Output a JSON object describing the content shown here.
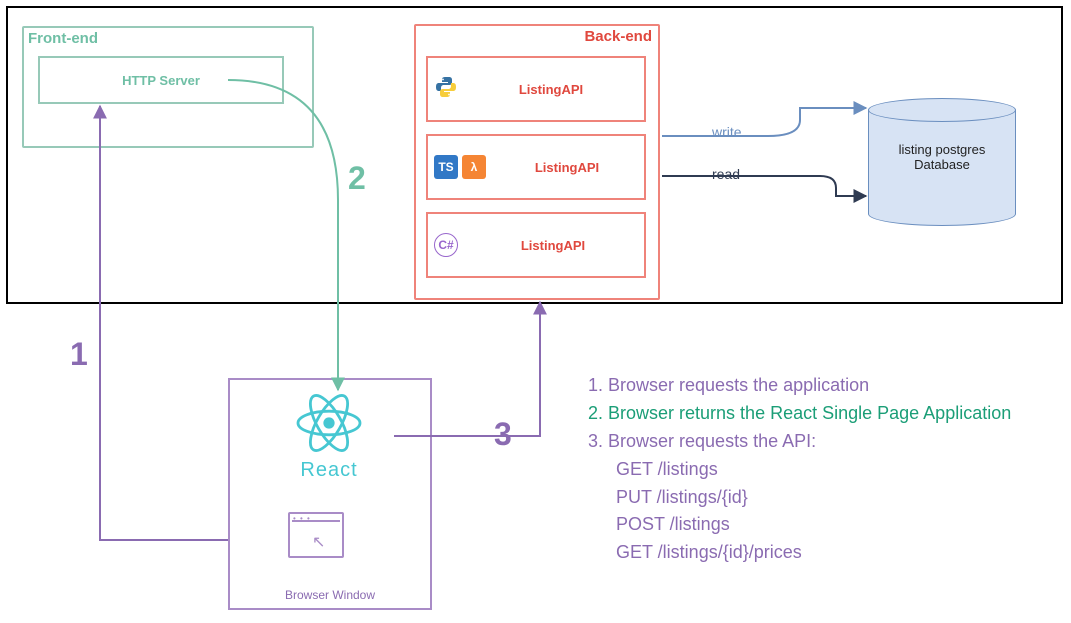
{
  "boxes": {
    "frontend_title": "Front-end",
    "http_server": "HTTP Server",
    "backend_title": "Back-end",
    "api1": "ListingAPI",
    "api2": "ListingAPI",
    "api3": "ListingAPI",
    "db_line1": "listing postgres",
    "db_line2": "Database",
    "browser_label": "Browser Window",
    "react_label": "React"
  },
  "icons": {
    "ts": "TS",
    "lambda": "λ",
    "csharp": "C#"
  },
  "steps": {
    "one": "1",
    "two": "2",
    "three": "3"
  },
  "edges": {
    "write": "write",
    "read": "read"
  },
  "legend": {
    "l1": "1. Browser requests the application",
    "l2": "2. Browser returns the React Single Page Application",
    "l3": "3. Browser requests the API:",
    "api_calls": [
      "GET /listings",
      "PUT /listings/{id}",
      "POST /listings",
      "GET /listings/{id}/prices"
    ]
  },
  "chart_data": {
    "type": "diagram",
    "nodes": [
      {
        "id": "frontend",
        "label": "Front-end",
        "children": [
          "http_server"
        ]
      },
      {
        "id": "http_server",
        "label": "HTTP Server"
      },
      {
        "id": "backend",
        "label": "Back-end",
        "children": [
          "api_python",
          "api_ts_lambda",
          "api_csharp"
        ]
      },
      {
        "id": "api_python",
        "label": "ListingAPI",
        "tech": [
          "python"
        ]
      },
      {
        "id": "api_ts_lambda",
        "label": "ListingAPI",
        "tech": [
          "typescript",
          "aws-lambda"
        ]
      },
      {
        "id": "api_csharp",
        "label": "ListingAPI",
        "tech": [
          "csharp"
        ]
      },
      {
        "id": "database",
        "label": "listing postgres Database"
      },
      {
        "id": "browser",
        "label": "Browser Window",
        "contains": [
          "react"
        ]
      },
      {
        "id": "react",
        "label": "React"
      }
    ],
    "edges": [
      {
        "from": "browser",
        "to": "http_server",
        "label": "1",
        "meaning": "Browser requests the application"
      },
      {
        "from": "http_server",
        "to": "react",
        "label": "2",
        "meaning": "Browser returns the React Single Page Application"
      },
      {
        "from": "react",
        "to": "backend",
        "label": "3",
        "meaning": "Browser requests the API"
      },
      {
        "from": "backend",
        "to": "database",
        "label": "write"
      },
      {
        "from": "backend",
        "to": "database",
        "label": "read"
      }
    ],
    "api_endpoints": [
      "GET /listings",
      "PUT /listings/{id}",
      "POST /listings",
      "GET /listings/{id}/prices"
    ]
  }
}
